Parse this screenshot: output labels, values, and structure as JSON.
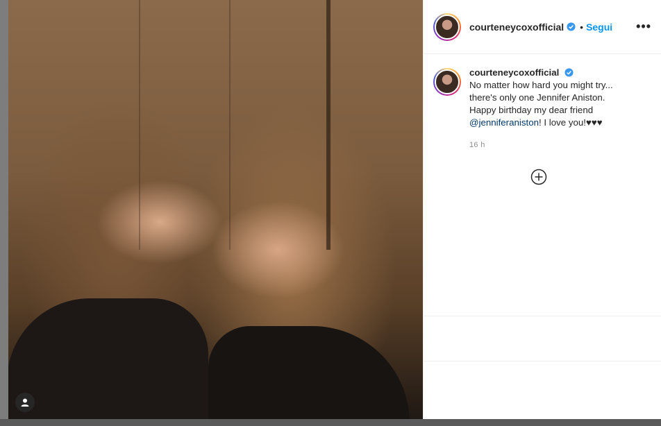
{
  "post": {
    "username": "courteneycoxofficial",
    "follow_label": "Segui",
    "separator": "•",
    "more_label": "•••"
  },
  "caption": {
    "username": "courteneycoxofficial",
    "line1": "No matter how hard you might try...",
    "line2": "there's only one Jennifer Aniston.",
    "line3": "Happy birthday my dear friend",
    "mention": "@jenniferaniston",
    "line4_rest": "! I love you!♥♥♥",
    "time": "16 h"
  },
  "icons": {
    "verified": "verified-badge-icon",
    "plus": "plus-circle-icon",
    "user": "user-icon"
  },
  "colors": {
    "accent": "#0095f6",
    "verified": "#3897f0",
    "mention": "#00376b"
  }
}
